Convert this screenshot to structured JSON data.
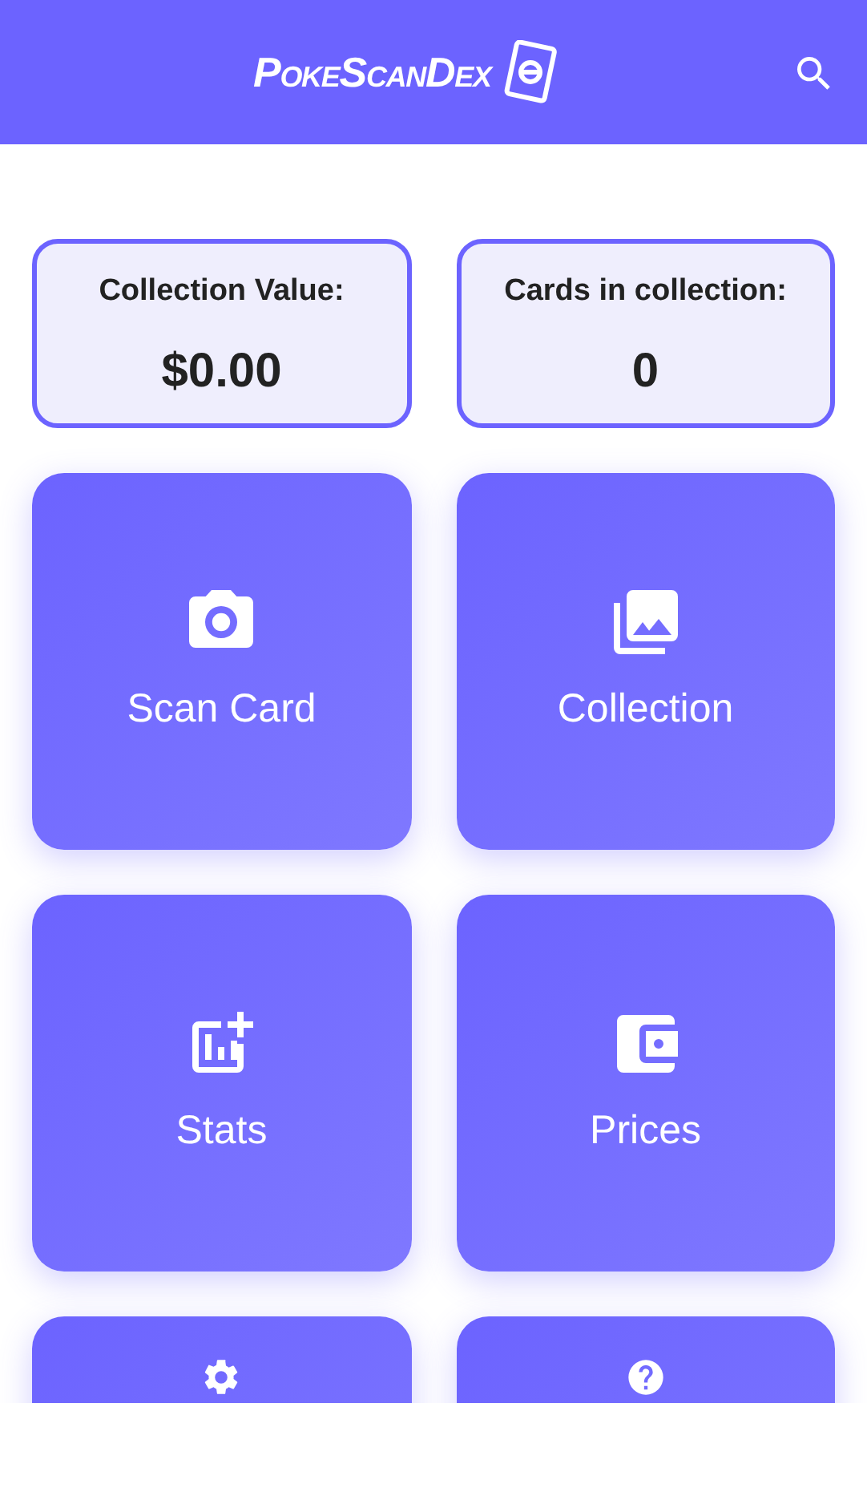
{
  "app_bar": {
    "logo": "PokeScanDex"
  },
  "stats": [
    {
      "label": "Collection Value:",
      "value": "$0.00"
    },
    {
      "label": "Cards in collection:",
      "value": "0"
    }
  ],
  "tiles": [
    {
      "kind": "camera",
      "label": "Scan Card"
    },
    {
      "kind": "gallery",
      "label": "Collection"
    },
    {
      "kind": "stats",
      "label": "Stats"
    },
    {
      "kind": "wallet",
      "label": "Prices"
    },
    {
      "kind": "settings"
    },
    {
      "kind": "help"
    }
  ]
}
